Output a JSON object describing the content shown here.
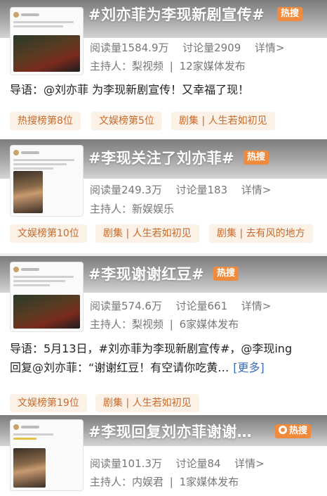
{
  "colors": {
    "hot_badge": "#f08a3c",
    "tag_text": "#c86a2c",
    "tag_bg": "#fbf1e6",
    "link": "#3b6db5"
  },
  "cards": [
    {
      "title": "#刘亦菲为李现新剧宣传#",
      "badge": "热搜",
      "reads": "阅读量1584.9万",
      "discuss": "讨论量2909",
      "details": "详情>",
      "host": "主持人：梨视频",
      "media": "12家媒体发布",
      "guide": "导语：@刘亦菲 为李现新剧宣传！又幸福了现！",
      "tags": [
        "热搜榜第8位",
        "文娱榜第5位",
        "剧集 | 人生若如初见"
      ]
    },
    {
      "title": "#李现关注了刘亦菲#",
      "badge": "热搜",
      "reads": "阅读量249.3万",
      "discuss": "讨论量183",
      "details": "详情>",
      "host": "主持人：新娱娱乐",
      "tags": [
        "文娱榜第10位",
        "剧集 | 人生若如初见",
        "剧集 | 去有风的地方"
      ]
    },
    {
      "title": "#李现谢谢红豆#",
      "badge": "热搜",
      "reads": "阅读量574.6万",
      "discuss": "讨论量661",
      "details": "详情>",
      "host": "主持人：梨视频",
      "media": "6家媒体发布",
      "guide_line1": "导语：5月13日，#刘亦菲为李现新剧宣传#，@李现ing",
      "guide_line2": "回复@刘亦菲：“谢谢红豆！有空请你吃黄…",
      "more": "[更多]",
      "tags": [
        "文娱榜第19位",
        "剧集 | 人生若如初见"
      ]
    },
    {
      "title": "#李现回复刘亦菲谢谢…",
      "badge": "热搜",
      "reads": "阅读量101.3万",
      "discuss": "讨论量84",
      "details": "详情>",
      "host": "主持人：内娱君",
      "media": "1家媒体发布"
    }
  ]
}
